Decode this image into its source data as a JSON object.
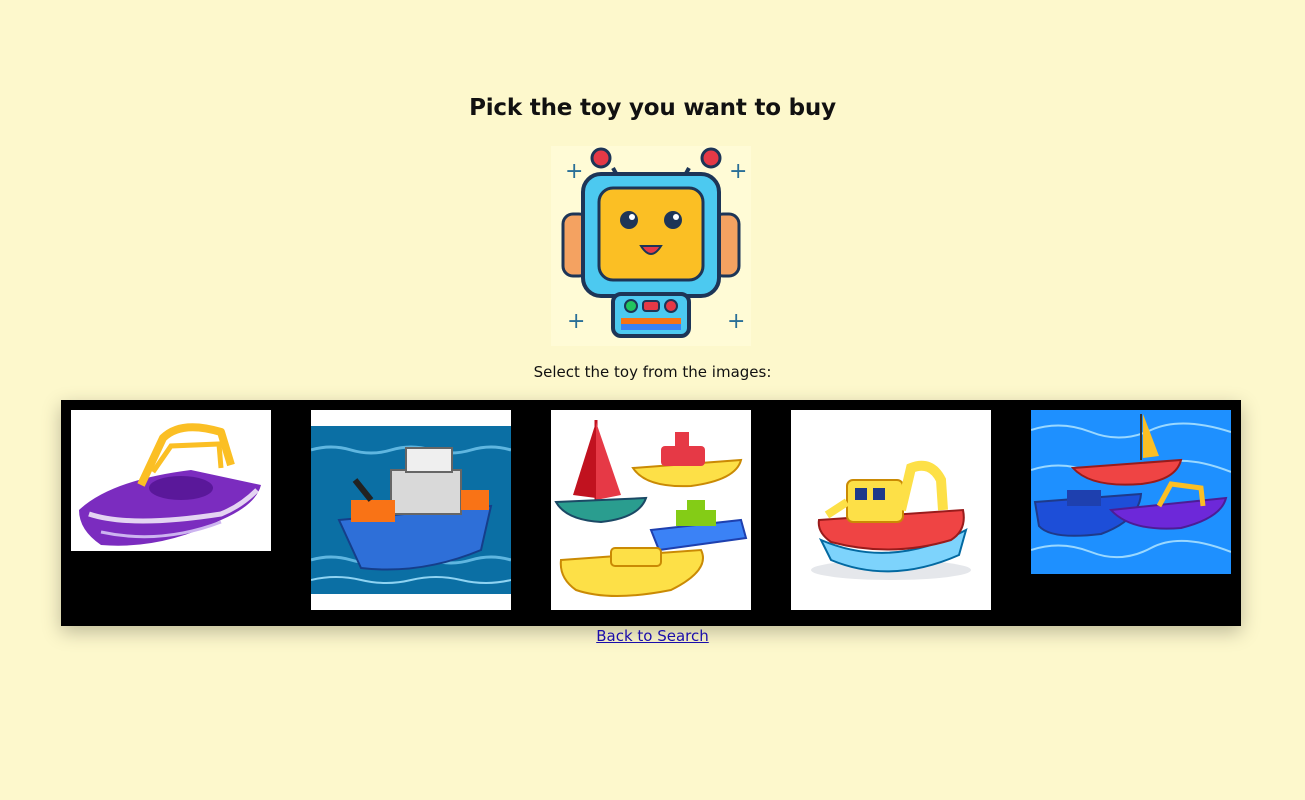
{
  "page": {
    "title": "Pick the toy you want to buy",
    "instruction": "Select the toy from the images:",
    "back_link": "Back to Search"
  },
  "mascot": {
    "icon": "robot-mascot-icon"
  },
  "toys": [
    {
      "icon": "purple-speedboat-toy-icon"
    },
    {
      "icon": "blue-rescue-ship-toy-icon"
    },
    {
      "icon": "boat-set-toy-icon"
    },
    {
      "icon": "tugboat-toy-icon"
    },
    {
      "icon": "boats-in-pool-toy-icon"
    }
  ],
  "colors": {
    "background": "#fdf8cc",
    "gallery_background": "#000000",
    "link": "#1a0dab"
  }
}
